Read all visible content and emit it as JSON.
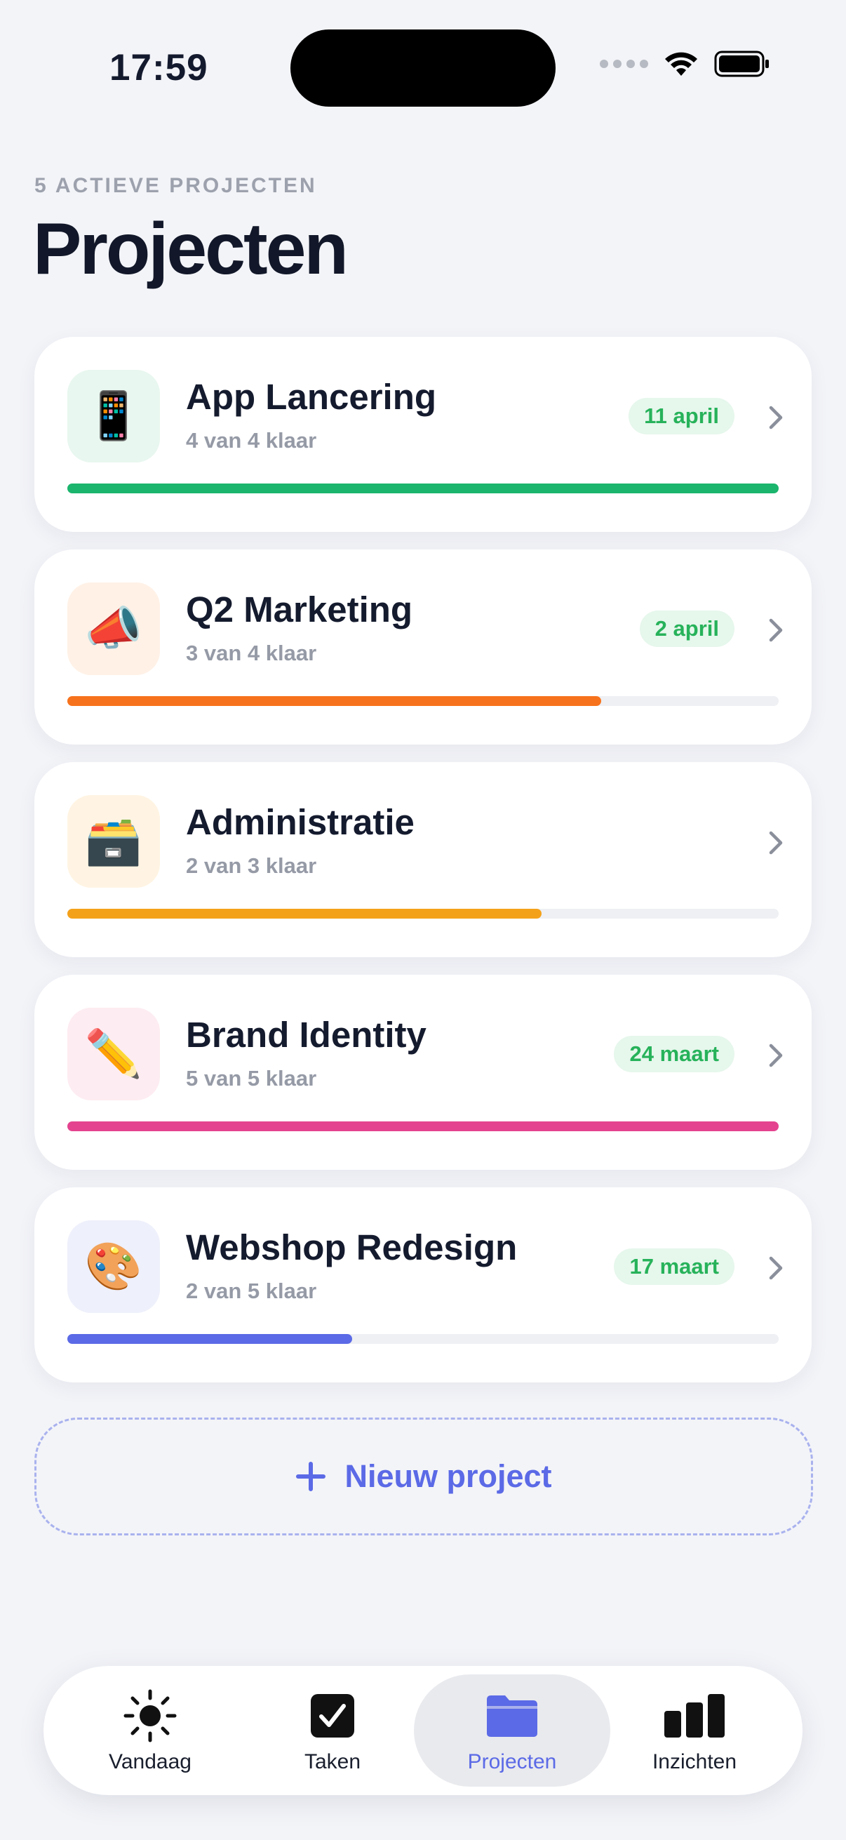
{
  "status_bar": {
    "time": "17:59"
  },
  "header": {
    "subtitle": "5 ACTIEVE PROJECTEN",
    "title": "Projecten"
  },
  "projects": [
    {
      "name": "App Lancering",
      "progress_text": "4 van 4 klaar",
      "due": "11 april",
      "emoji": "📱",
      "icon_bg": "#e8f7ef",
      "bar_color": "#1bb56d",
      "progress": 1.0
    },
    {
      "name": "Q2 Marketing",
      "progress_text": "3 van 4 klaar",
      "due": "2 april",
      "emoji": "📣",
      "icon_bg": "#fff1e6",
      "bar_color": "#f7721c",
      "progress": 0.75
    },
    {
      "name": "Administratie",
      "progress_text": "2 van 3 klaar",
      "due": "",
      "emoji": "🗃️",
      "icon_bg": "#fff4e3",
      "bar_color": "#f4a11a",
      "progress": 0.667
    },
    {
      "name": "Brand Identity",
      "progress_text": "5 van 5 klaar",
      "due": "24 maart",
      "emoji": "✏️",
      "icon_bg": "#fdecf1",
      "bar_color": "#e4438f",
      "progress": 1.0
    },
    {
      "name": "Webshop Redesign",
      "progress_text": "2 van 5 klaar",
      "due": "17 maart",
      "emoji": "🎨",
      "icon_bg": "#eef0fb",
      "bar_color": "#5b6ae6",
      "progress": 0.4
    }
  ],
  "new_project_label": "Nieuw project",
  "tabbar": {
    "tabs": [
      {
        "label": "Vandaag",
        "icon": "sun-icon"
      },
      {
        "label": "Taken",
        "icon": "checkbox-icon"
      },
      {
        "label": "Projecten",
        "icon": "folder-icon",
        "active": true
      },
      {
        "label": "Inzichten",
        "icon": "bar-chart-icon"
      }
    ]
  },
  "colors": {
    "accent": "#5b6ae6",
    "badge_text": "#27b25a",
    "badge_bg": "#e6f7ec"
  }
}
